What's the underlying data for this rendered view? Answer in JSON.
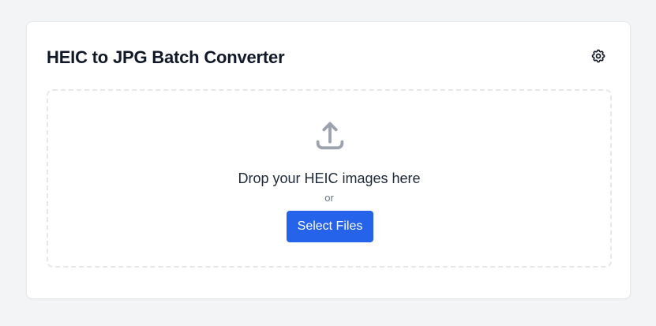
{
  "app": {
    "title": "HEIC to JPG Batch Converter"
  },
  "header": {
    "settings_icon": "gear-icon"
  },
  "dropzone": {
    "icon": "upload-icon",
    "prompt": "Drop your HEIC images here",
    "separator": "or",
    "select_button_label": "Select Files"
  },
  "colors": {
    "accent": "#2563eb",
    "background": "#f3f4f6",
    "card": "#ffffff",
    "border": "#e5e7eb",
    "icon_muted": "#9ca3af",
    "title_text": "#111827"
  }
}
